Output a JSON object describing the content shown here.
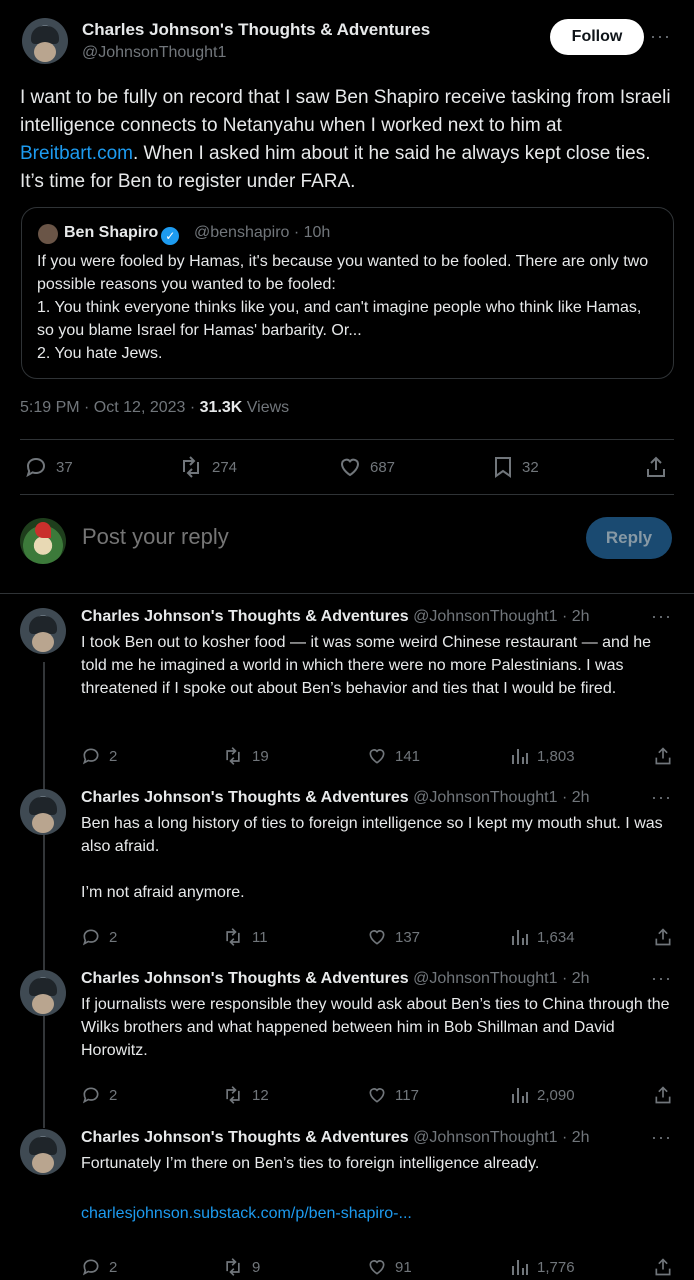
{
  "main": {
    "author_name": "Charles Johnson's Thoughts & Adventures",
    "author_handle": "@JohnsonThought1",
    "follow_label": "Follow",
    "more_label": "···",
    "text_before": "I want to be fully on record that I saw Ben Shapiro receive tasking from Israeli intelligence connects to Netanyahu when I worked next to him at ",
    "text_link": "Breitbart.com",
    "text_after": ". When I asked him about it he said he always kept close ties. It’s time for Ben to register under FARA.",
    "quote": {
      "name": "Ben Shapiro",
      "verified": "✓",
      "handle_time": "@benshapiro · 10h",
      "text": "If you were fooled by Hamas, it's because you wanted to be fooled. There are only two possible reasons you wanted to be fooled:\n1. You think everyone thinks like you, and can't imagine people who think like Hamas, so you blame Israel for Hamas' barbarity. Or...\n2. You hate Jews."
    },
    "time": "5:19 PM · Oct 12, 2023 · ",
    "views_count": "31.3K",
    "views_label": " Views",
    "stats": {
      "replies": "37",
      "reposts": "274",
      "likes": "687",
      "bookmarks": "32"
    }
  },
  "compose": {
    "placeholder": "Post your reply",
    "button": "Reply"
  },
  "icons": {
    "reply": "reply-icon",
    "repost": "repost-icon",
    "like": "like-icon",
    "bookmark": "bookmark-icon",
    "share": "share-icon",
    "views": "views-icon"
  },
  "replies": [
    {
      "name": "Charles Johnson's Thoughts & Adventures",
      "handle_time": " @JohnsonThought1 · 2h",
      "text": "I took Ben out to kosher food — it was some weird Chinese restaurant — and he told me he imagined a world in which there were no more Palestinians. I was threatened if I spoke out about Ben’s behavior and ties that I would be fired.",
      "replies": "2",
      "reposts": "19",
      "likes": "141",
      "views": "1,803"
    },
    {
      "name": "Charles Johnson's Thoughts & Adventures",
      "handle_time": " @JohnsonThought1 · 2h",
      "text": "Ben has a long history of ties to foreign intelligence so I kept my mouth shut. I was also afraid.\n\nI’m not afraid anymore.",
      "replies": "2",
      "reposts": "11",
      "likes": "137",
      "views": "1,634"
    },
    {
      "name": "Charles Johnson's Thoughts & Adventures",
      "handle_time": " @JohnsonThought1 · 2h",
      "text": "If journalists were responsible they would ask about Ben’s ties to China through the Wilks brothers and what happened between him in Bob Shillman and David Horowitz.",
      "replies": "2",
      "reposts": "12",
      "likes": "117",
      "views": "2,090"
    },
    {
      "name": "Charles Johnson's Thoughts & Adventures",
      "handle_time": " @JohnsonThought1 · 2h",
      "text": "Fortunately I’m there on Ben’s ties to foreign intelligence already.",
      "link": "charlesjohnson.substack.com/p/ben-shapiro-...",
      "replies": "2",
      "reposts": "9",
      "likes": "91",
      "views": "1,776"
    }
  ]
}
